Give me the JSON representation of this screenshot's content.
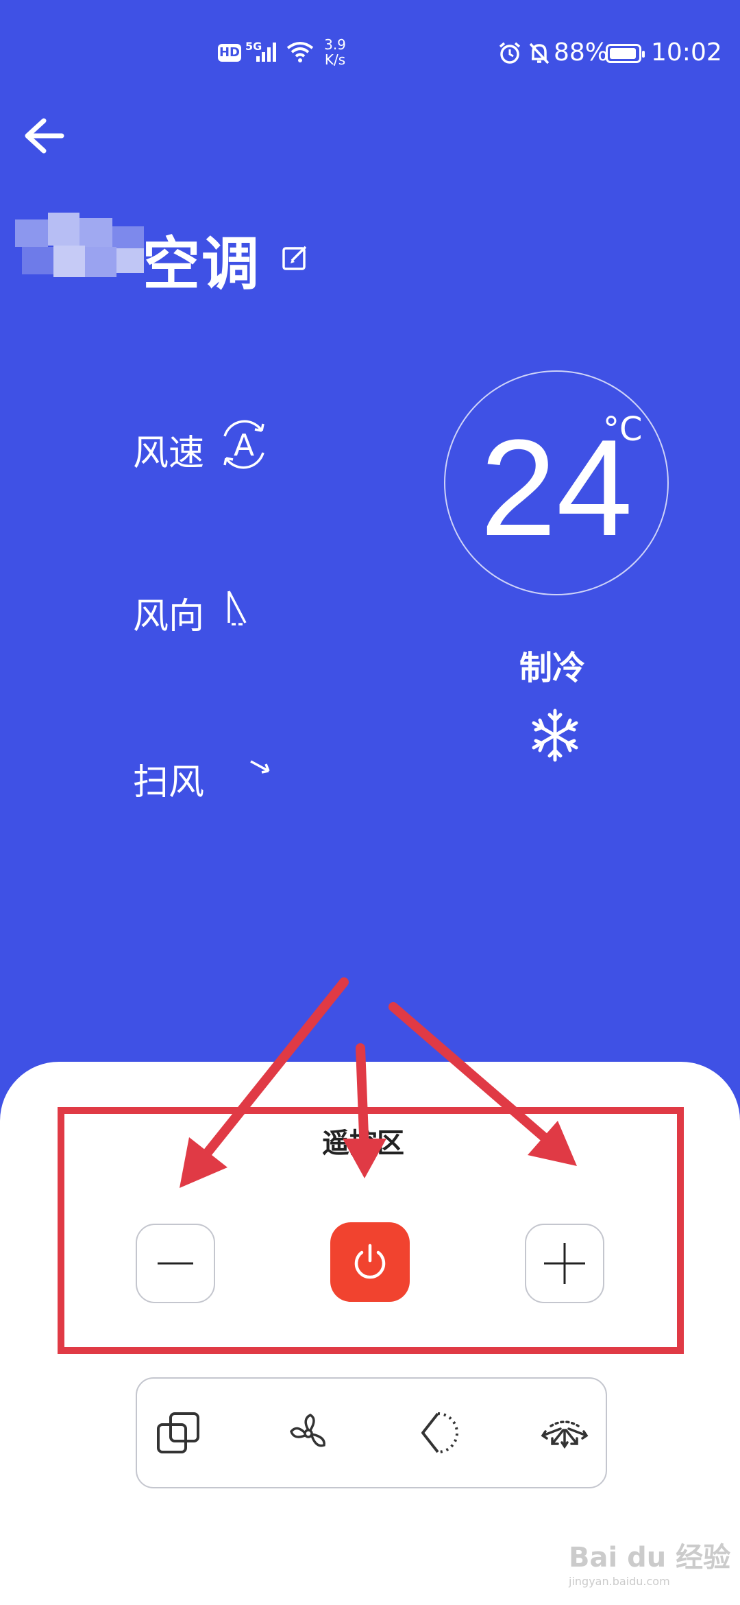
{
  "status_bar": {
    "left_badges": [
      "HD",
      "5G"
    ],
    "net_speed_top": "3.9",
    "net_speed_bottom": "K/s",
    "battery_percent": "88%",
    "time": "10:02"
  },
  "header": {
    "back_icon": "arrow-left-icon",
    "edit_icon": "edit-icon"
  },
  "device": {
    "title_suffix": "空调"
  },
  "controls": {
    "fan_speed": {
      "label": "风速",
      "icon": "auto-fan-icon",
      "icon_text": "A"
    },
    "wind_direction": {
      "label": "风向",
      "icon": "wind-direction-icon"
    },
    "swing": {
      "label": "扫风",
      "icon": "swing-arrow-icon"
    }
  },
  "temperature": {
    "value": "24",
    "unit": "°C"
  },
  "mode": {
    "label": "制冷",
    "icon": "snowflake-icon"
  },
  "remote": {
    "title": "遥控区",
    "minus_icon": "minus-icon",
    "power_icon": "power-icon",
    "plus_icon": "plus-icon"
  },
  "function_bar": {
    "icons": [
      "copy-mode-icon",
      "fan-icon",
      "angle-icon",
      "sweep-icon"
    ]
  },
  "watermark": {
    "text": "Bai du 经验",
    "sub": "jingyan.baidu.com"
  },
  "colors": {
    "background": "#3F51E5",
    "panel": "#FFFFFF",
    "power_button": "#F1432F",
    "annotation": "#E03A45"
  }
}
